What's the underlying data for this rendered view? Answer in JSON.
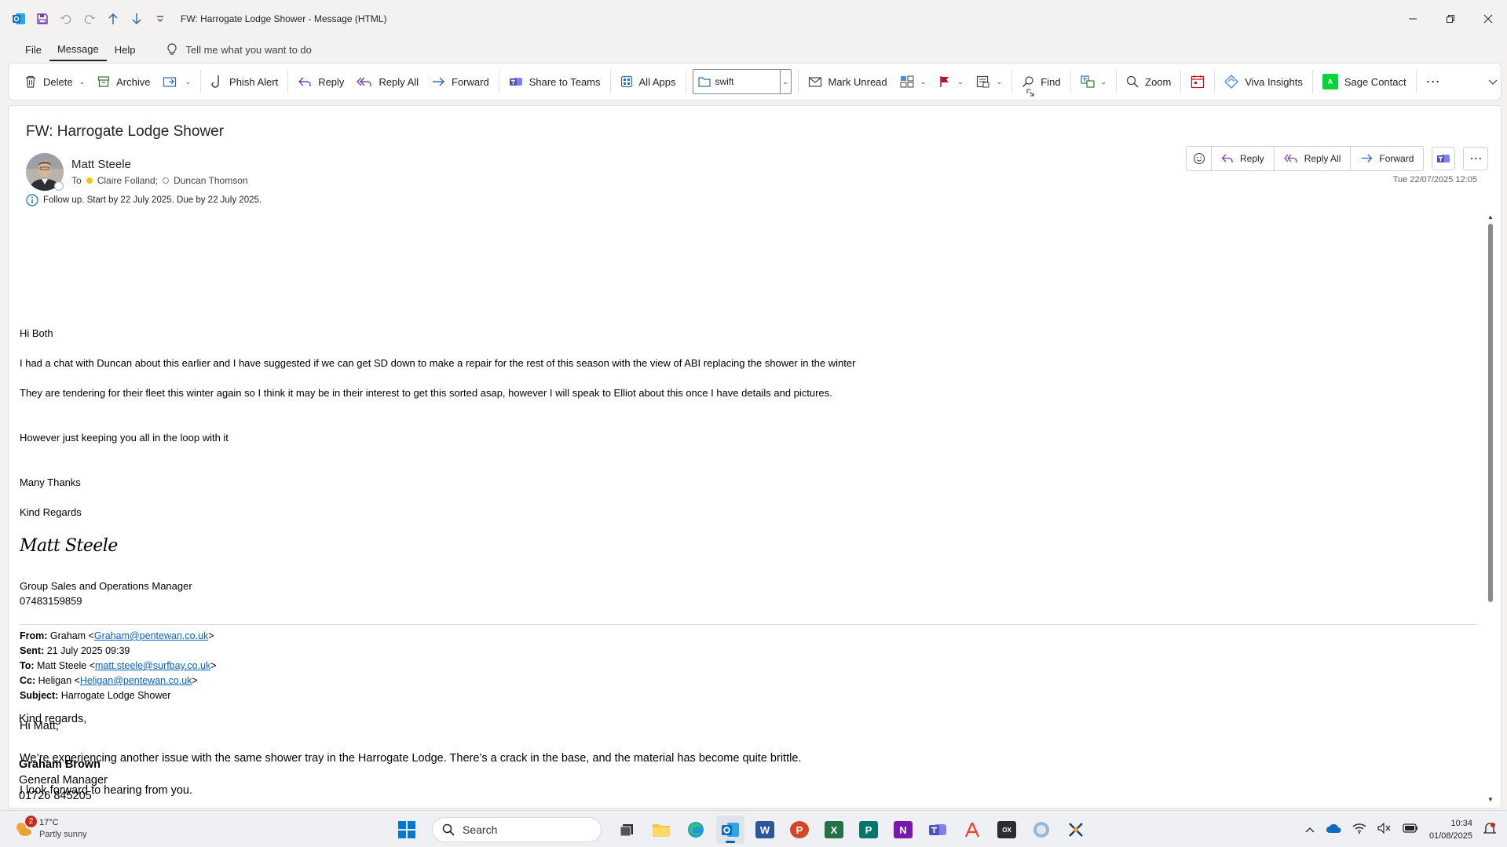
{
  "window": {
    "title": "FW: Harrogate Lodge Shower  -  Message (HTML)"
  },
  "menu": {
    "items": [
      "File",
      "Message",
      "Help"
    ],
    "tell_me": "Tell me what you want to do"
  },
  "ribbon": {
    "delete": "Delete",
    "archive": "Archive",
    "phish_alert": "Phish Alert",
    "reply": "Reply",
    "reply_all": "Reply All",
    "forward": "Forward",
    "share_to_teams": "Share to Teams",
    "all_apps": "All Apps",
    "quick_step_value": "swift",
    "mark_unread": "Mark Unread",
    "find": "Find",
    "zoom": "Zoom",
    "viva_insights": "Viva Insights",
    "sage_contact": "Sage Contact"
  },
  "message": {
    "subject": "FW: Harrogate Lodge Shower",
    "sender": "Matt Steele",
    "to_label": "To",
    "recipients": [
      "Claire Folland;",
      "Duncan Thomson"
    ],
    "follow_up": "Follow up.  Start by 22 July 2025.  Due by 22 July 2025.",
    "date": "Tue 22/07/2025 12:05",
    "actions": {
      "reply": "Reply",
      "reply_all": "Reply All",
      "forward": "Forward"
    },
    "body": {
      "greeting": "Hi Both",
      "p1": "I had a chat with Duncan about this earlier and I have suggested if we can get SD down to make a repair for the rest of this season with the view of ABI replacing the shower in the winter",
      "p2": "They are tendering for their fleet this winter again so I think it may be in their interest to get this sorted asap, however I will speak to Elliot about this once I have details and pictures.",
      "p3": "However just keeping you all in the loop with it",
      "thanks": "Many Thanks",
      "regards": "Kind Regards",
      "signature": "Matt Steele",
      "sig_title": "Group Sales and Operations Manager",
      "sig_phone": "07483159859"
    },
    "forwarded": {
      "from_label": "From:",
      "from_name": "Graham <",
      "from_email": "Graham@pentewan.co.uk",
      "sent_label": "Sent:",
      "sent": "21 July 2025 09:39",
      "to_label": "To:",
      "to_name": "Matt Steele <",
      "to_email": "matt.steele@surfbay.co.uk",
      "cc_label": "Cc:",
      "cc_name": "Heligan <",
      "cc_email": "Heligan@pentewan.co.uk",
      "subject_label": "Subject:",
      "subject": "Harrogate Lodge Shower",
      "greeting": "Hi Matt,",
      "p1": "We’re experiencing another issue with the same shower tray in the Harrogate Lodge. There’s a crack in the base, and the material has become quite brittle.",
      "p2": "I look forward to hearing from you.",
      "closing": "Kind regards,",
      "name": "Graham Brown",
      "title": "General Manager",
      "phone": "01726 845205"
    }
  },
  "taskbar": {
    "weather_badge": "2",
    "temperature": "17°C",
    "condition": "Partly sunny",
    "search_placeholder": "Search",
    "time": "10:34",
    "date": "01/08/2025"
  },
  "colors": {
    "outlook_blue": "#0f6cbd",
    "flag_red": "#c50f1f",
    "link": "#0563c1",
    "sage_green": "#00d639"
  }
}
